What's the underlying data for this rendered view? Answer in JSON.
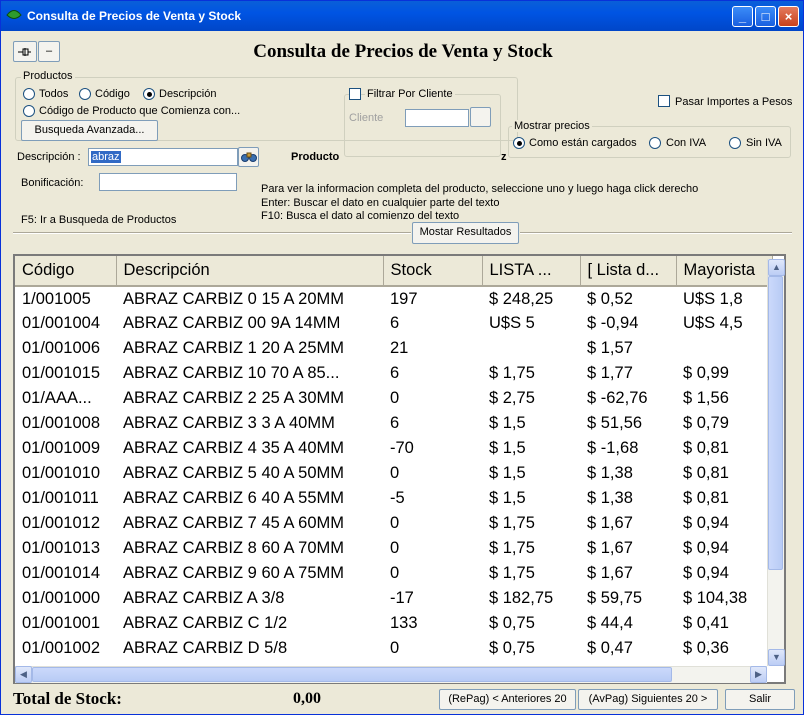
{
  "window": {
    "title": "Consulta de Precios de Venta y Stock"
  },
  "header": {
    "pin_label": "-¤",
    "minus_label": "–",
    "title": "Consulta de Precios de Venta y Stock"
  },
  "productos": {
    "legend": "Productos",
    "options": [
      "Todos",
      "Código",
      "Descripción",
      "Código de Producto que Comienza con..."
    ],
    "selected": "Descripción",
    "advanced_button": "Busqueda Avanzada..."
  },
  "filtro": {
    "legend": "Filtrar Por Cliente",
    "cliente_label": "Cliente",
    "cliente_value": ""
  },
  "pasar_pesos": "Pasar Importes a Pesos",
  "mostrar": {
    "legend": "Mostrar precios",
    "options": [
      "Como están cargados",
      "Con IVA",
      "Sin IVA"
    ],
    "selected": "Como están cargados"
  },
  "form": {
    "descripcion_label": "Descripción :",
    "descripcion_value": "abraz",
    "bonificacion_label": "Bonificación:",
    "bonificacion_value": "",
    "producto_label": "Producto",
    "producto_trailing": "z",
    "f5_hint": "F5: Ir a Busqueda de Productos"
  },
  "hints": [
    "Para ver la informacion completa del producto, seleccione uno y luego haga click derecho",
    "Enter: Buscar el dato en cualquier parte del texto",
    "F10: Busca el dato al comienzo del texto"
  ],
  "mostrar_resultados": "Mostar Resultados",
  "table": {
    "columns": [
      "Código",
      "Descripción",
      "Stock",
      "LISTA ...",
      "[ Lista d...",
      "Mayorista"
    ],
    "rows": [
      [
        "1/001005",
        "ABRAZ CARBIZ 0 15 A 20MM",
        "197",
        "$ 248,25",
        "$ 0,52",
        "U$S 1,8"
      ],
      [
        "01/001004",
        "ABRAZ CARBIZ 00 9A 14MM",
        "6",
        "U$S 5",
        "$ -0,94",
        "U$S 4,5"
      ],
      [
        "01/001006",
        "ABRAZ CARBIZ 1 20 A 25MM",
        "21",
        "",
        "$ 1,57",
        ""
      ],
      [
        "01/001015",
        "ABRAZ CARBIZ 10 70 A 85...",
        "6",
        "$ 1,75",
        "$ 1,77",
        "$ 0,99"
      ],
      [
        "01/AAA...",
        "ABRAZ CARBIZ 2 25 A 30MM",
        "0",
        "$ 2,75",
        "$ -62,76",
        "$ 1,56"
      ],
      [
        "01/001008",
        "ABRAZ CARBIZ 3 3 A 40MM",
        "6",
        "$ 1,5",
        "$ 51,56",
        "$ 0,79"
      ],
      [
        "01/001009",
        "ABRAZ CARBIZ 4 35 A 40MM",
        "-70",
        "$ 1,5",
        "$ -1,68",
        "$ 0,81"
      ],
      [
        "01/001010",
        "ABRAZ CARBIZ 5 40 A 50MM",
        "0",
        "$ 1,5",
        "$ 1,38",
        "$ 0,81"
      ],
      [
        "01/001011",
        "ABRAZ CARBIZ 6 40 A 55MM",
        "-5",
        "$ 1,5",
        "$ 1,38",
        "$ 0,81"
      ],
      [
        "01/001012",
        "ABRAZ CARBIZ 7 45 A 60MM",
        "0",
        "$ 1,75",
        "$ 1,67",
        "$ 0,94"
      ],
      [
        "01/001013",
        "ABRAZ CARBIZ 8 60 A 70MM",
        "0",
        "$ 1,75",
        "$ 1,67",
        "$ 0,94"
      ],
      [
        "01/001014",
        "ABRAZ CARBIZ 9 60 A 75MM",
        "0",
        "$ 1,75",
        "$ 1,67",
        "$ 0,94"
      ],
      [
        "01/001000",
        "ABRAZ CARBIZ A 3/8",
        "-17",
        "$ 182,75",
        "$ 59,75",
        "$ 104,38"
      ],
      [
        "01/001001",
        "ABRAZ CARBIZ C 1/2",
        "133",
        "$ 0,75",
        "$ 44,4",
        "$ 0,41"
      ],
      [
        "01/001002",
        "ABRAZ CARBIZ D 5/8",
        "0",
        "$ 0,75",
        "$ 0,47",
        "$ 0,36"
      ]
    ]
  },
  "footer": {
    "total_label": "Total de Stock:",
    "total_value": "0,00",
    "prev_button": "(RePag) < Anteriores 20",
    "next_button": "(AvPag) Siguientes 20 >",
    "exit_button": "Salir"
  },
  "colors": {
    "titlebar": "#0054e3",
    "selection": "#316ac5",
    "face": "#ece9d8"
  }
}
